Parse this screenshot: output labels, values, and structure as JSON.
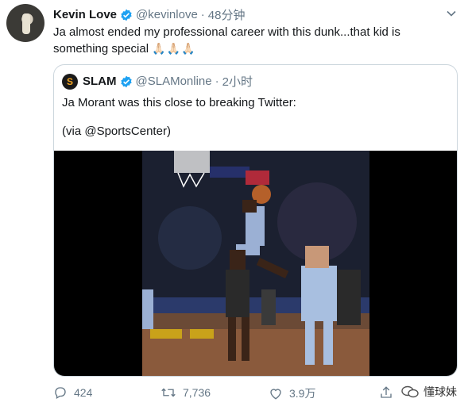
{
  "tweet": {
    "author_name": "Kevin Love",
    "handle": "@kevinlove",
    "separator": "·",
    "time": "48分钟",
    "text": "Ja almost ended my professional career with this dunk...that kid is something special",
    "emoji": "🙏🏻🙏🏻🙏🏻"
  },
  "quoted": {
    "author_name": "SLAM",
    "logo_letter": "S",
    "handle": "@SLAMonline",
    "separator": "·",
    "time": "2小时",
    "text": "Ja Morant was this close to breaking Twitter:",
    "via": "(via @SportsCenter)"
  },
  "actions": {
    "replies": "424",
    "retweets": "7,736",
    "likes": "3.9万"
  },
  "watermark": "懂球妹",
  "colors": {
    "verified": "#1da1f2",
    "secondary_text": "#657786",
    "border": "#ccd6dd"
  }
}
